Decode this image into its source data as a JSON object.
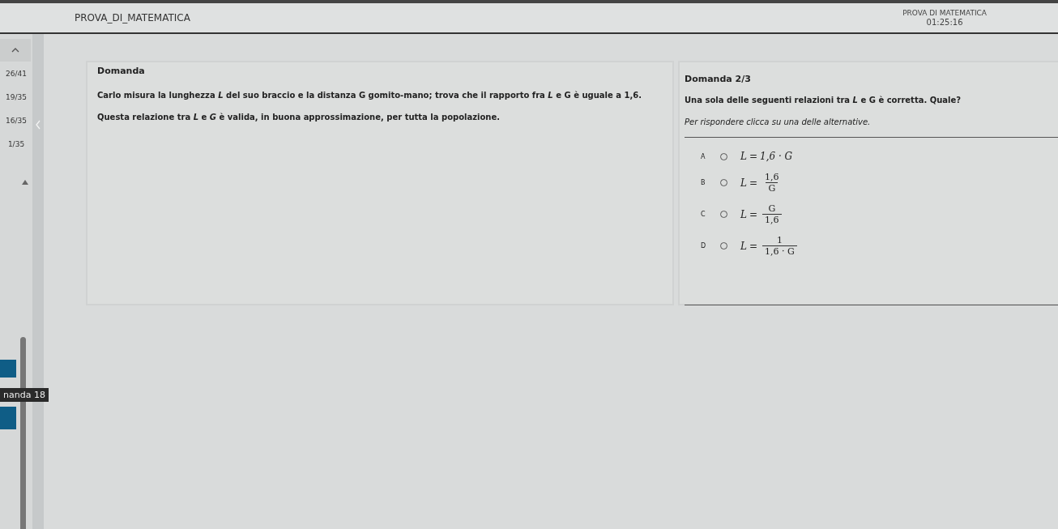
{
  "header": {
    "title": "PROVA_DI_MATEMATICA",
    "test_name": "PROVA DI MATEMATICA",
    "timer": "01:25:16"
  },
  "sidebar": {
    "scores": [
      "26/41",
      "19/35",
      "16/35",
      "1/35"
    ],
    "tooltip": "nanda 18"
  },
  "stimulus": {
    "heading": "Domanda",
    "paragraphs": [
      "Carlo misura la lunghezza *L* del suo braccio e la distanza G gomito-mano; trova che il rapporto fra *L* e G è uguale a 1,6.",
      "Questa relazione tra *L* e *G* è valida, in buona approssimazione, per tutta la popolazione."
    ]
  },
  "question": {
    "heading": "Domanda 2/3",
    "text": "Una sola delle seguenti relazioni tra *L* e G è corretta. Quale?",
    "instruction": "Per rispondere clicca su una delle alternative.",
    "options": [
      {
        "letter": "A",
        "selected": false,
        "kind": "inline",
        "lhs": "L",
        "eq": "=",
        "expr": "1,6 · G"
      },
      {
        "letter": "B",
        "selected": false,
        "kind": "fraction",
        "lhs": "L",
        "eq": "=",
        "numerator": "1,6",
        "denominator": "G"
      },
      {
        "letter": "C",
        "selected": false,
        "kind": "fraction",
        "lhs": "L",
        "eq": "=",
        "numerator": "G",
        "denominator": "1,6"
      },
      {
        "letter": "D",
        "selected": false,
        "kind": "fraction",
        "lhs": "L",
        "eq": "=",
        "numerator": "1",
        "denominator": "1,6 · G"
      }
    ]
  }
}
